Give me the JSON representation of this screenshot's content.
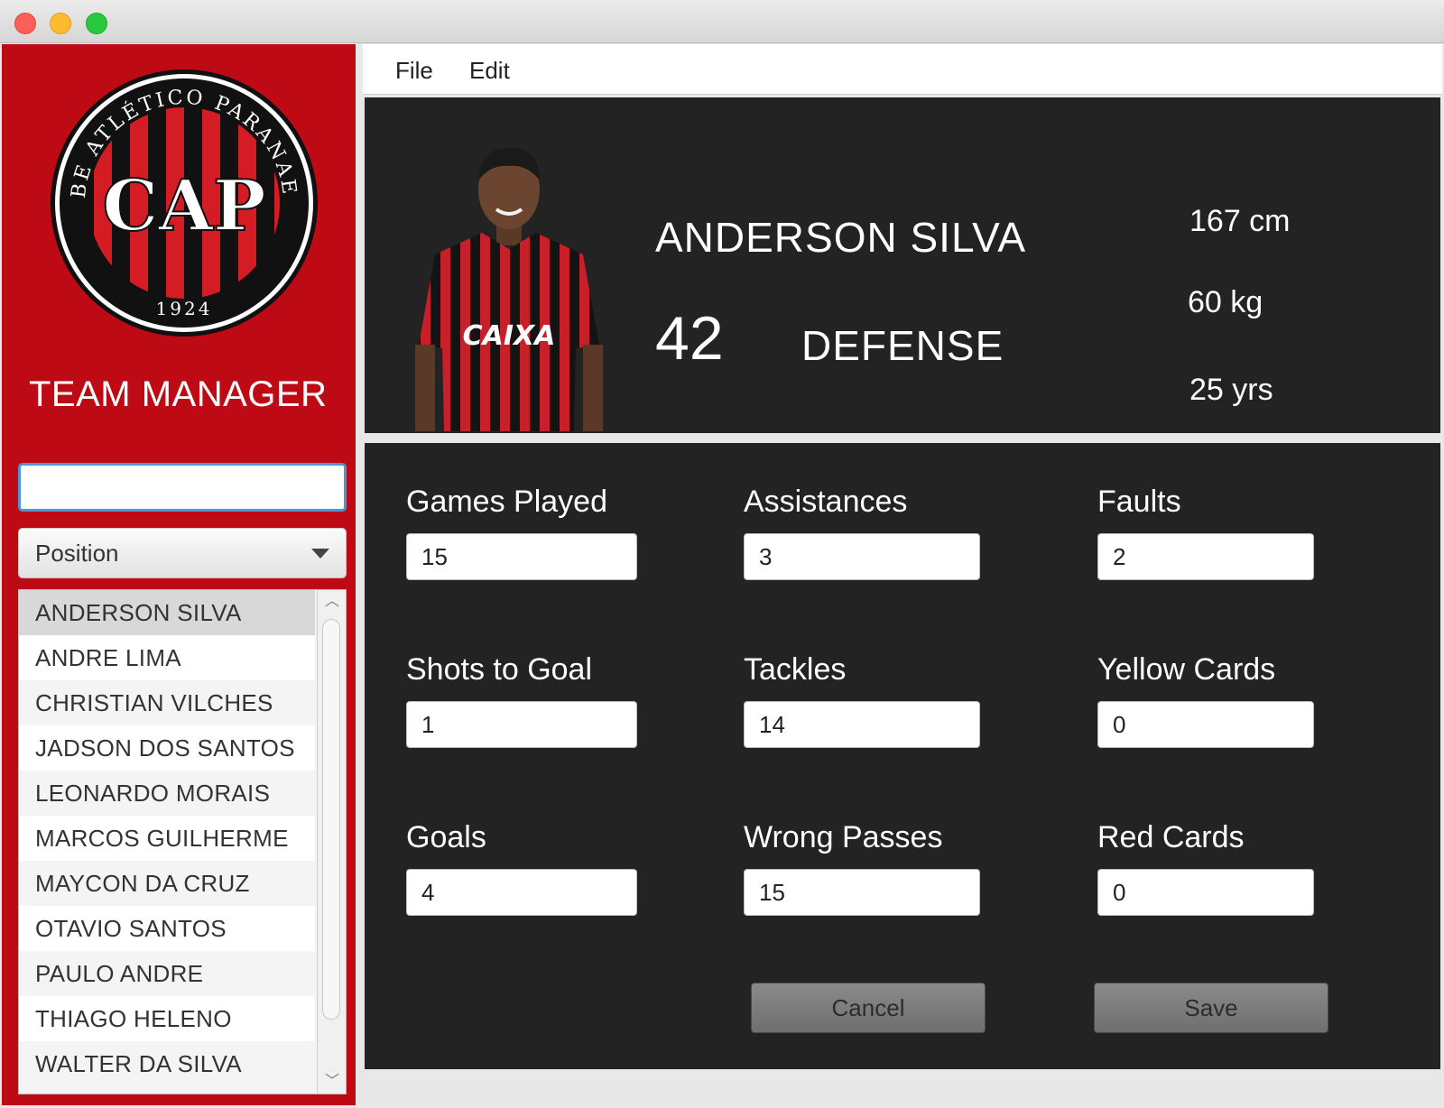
{
  "window": {
    "controls": [
      "close",
      "minimize",
      "maximize"
    ]
  },
  "sidebar": {
    "logo": {
      "ring_text": "CLUBE ATLÉTICO PARANAENSE",
      "year": "1924",
      "monogram": "CAP",
      "colors": {
        "red": "#d41c24",
        "black": "#111111"
      }
    },
    "app_title": "TEAM MANAGER",
    "search": {
      "value": "",
      "placeholder": ""
    },
    "position_filter": {
      "selected": "Position"
    },
    "players": [
      "ANDERSON SILVA",
      "ANDRE LIMA",
      "CHRISTIAN VILCHES",
      "JADSON DOS SANTOS",
      "LEONARDO MORAIS",
      "MARCOS GUILHERME",
      "MAYCON DA CRUZ",
      "OTAVIO SANTOS",
      "PAULO ANDRE",
      "THIAGO HELENO",
      "WALTER DA SILVA"
    ],
    "selected_player": "ANDERSON SILVA",
    "accent": "#bd0a14"
  },
  "menu": {
    "file": "File",
    "edit": "Edit"
  },
  "player": {
    "name": "ANDERSON SILVA",
    "number": "42",
    "position": "DEFENSE",
    "height": "167 cm",
    "weight": "60 kg",
    "age": "25 yrs",
    "jersey_sponsor": "CAIXA"
  },
  "stats": {
    "games_played": {
      "label": "Games Played",
      "value": "15"
    },
    "assistances": {
      "label": "Assistances",
      "value": "3"
    },
    "faults": {
      "label": "Faults",
      "value": "2"
    },
    "shots_to_goal": {
      "label": "Shots to Goal",
      "value": "1"
    },
    "tackles": {
      "label": "Tackles",
      "value": "14"
    },
    "yellow_cards": {
      "label": "Yellow Cards",
      "value": "0"
    },
    "goals": {
      "label": "Goals",
      "value": "4"
    },
    "wrong_passes": {
      "label": "Wrong Passes",
      "value": "15"
    },
    "red_cards": {
      "label": "Red Cards",
      "value": "0"
    }
  },
  "buttons": {
    "cancel": "Cancel",
    "save": "Save"
  }
}
